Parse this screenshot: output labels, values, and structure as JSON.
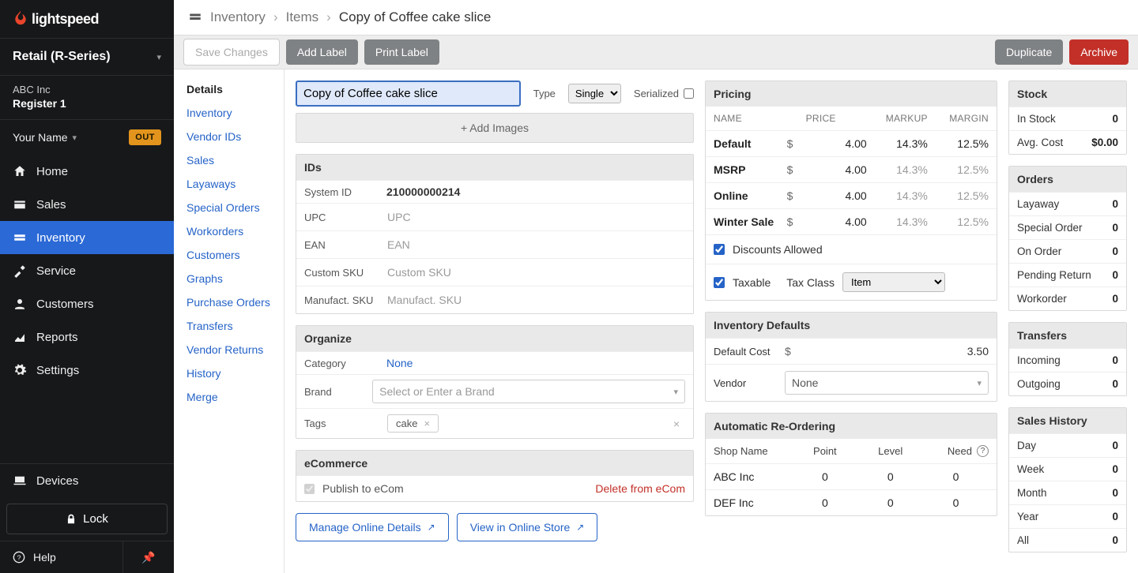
{
  "brand": {
    "name": "lightspeed"
  },
  "series": "Retail (R-Series)",
  "company": {
    "name": "ABC Inc",
    "register": "Register 1"
  },
  "user": {
    "name": "Your Name",
    "status_badge": "OUT"
  },
  "nav": {
    "home": "Home",
    "sales": "Sales",
    "inventory": "Inventory",
    "service": "Service",
    "customers": "Customers",
    "reports": "Reports",
    "settings": "Settings",
    "devices": "Devices",
    "lock": "Lock",
    "help": "Help"
  },
  "breadcrumb": {
    "l1": "Inventory",
    "l2": "Items",
    "l3": "Copy of Coffee cake slice"
  },
  "actions": {
    "save": "Save Changes",
    "add_label": "Add Label",
    "print_label": "Print Label",
    "duplicate": "Duplicate",
    "archive": "Archive"
  },
  "tabs": {
    "details": "Details",
    "inventory": "Inventory",
    "vendor_ids": "Vendor IDs",
    "sales": "Sales",
    "layaways": "Layaways",
    "special_orders": "Special Orders",
    "workorders": "Workorders",
    "customers": "Customers",
    "graphs": "Graphs",
    "purchase_orders": "Purchase Orders",
    "transfers": "Transfers",
    "vendor_returns": "Vendor Returns",
    "history": "History",
    "merge": "Merge"
  },
  "item": {
    "title": "Copy of Coffee cake slice",
    "type_label": "Type",
    "type_value": "Single",
    "serialized_label": "Serialized"
  },
  "add_images": "+ Add Images",
  "ids": {
    "head": "IDs",
    "system_id_label": "System ID",
    "system_id_value": "210000000214",
    "upc_label": "UPC",
    "upc_ph": "UPC",
    "ean_label": "EAN",
    "ean_ph": "EAN",
    "custom_sku_label": "Custom SKU",
    "custom_sku_ph": "Custom SKU",
    "manuf_sku_label": "Manufact. SKU",
    "manuf_sku_ph": "Manufact. SKU"
  },
  "organize": {
    "head": "Organize",
    "category_label": "Category",
    "category_value": "None",
    "brand_label": "Brand",
    "brand_ph": "Select or Enter a Brand",
    "tags_label": "Tags",
    "tag0": "cake"
  },
  "ecom": {
    "head": "eCommerce",
    "publish_label": "Publish to eCom",
    "delete_label": "Delete from eCom",
    "manage": "Manage Online Details",
    "view": "View in Online Store"
  },
  "pricing": {
    "head": "Pricing",
    "cols": {
      "name": "NAME",
      "price": "PRICE",
      "markup": "MARKUP",
      "margin": "MARGIN"
    },
    "rows": [
      {
        "name": "Default",
        "cur": "$",
        "price": "4.00",
        "markup": "14.3%",
        "margin": "12.5%",
        "default": true
      },
      {
        "name": "MSRP",
        "cur": "$",
        "price": "4.00",
        "markup": "14.3%",
        "margin": "12.5%"
      },
      {
        "name": "Online",
        "cur": "$",
        "price": "4.00",
        "markup": "14.3%",
        "margin": "12.5%"
      },
      {
        "name": "Winter Sale",
        "cur": "$",
        "price": "4.00",
        "markup": "14.3%",
        "margin": "12.5%"
      }
    ],
    "discounts_label": "Discounts Allowed",
    "taxable_label": "Taxable",
    "tax_class_label": "Tax Class",
    "tax_class_value": "Item"
  },
  "inv_defaults": {
    "head": "Inventory Defaults",
    "default_cost_label": "Default Cost",
    "default_cost_cur": "$",
    "default_cost_value": "3.50",
    "vendor_label": "Vendor",
    "vendor_value": "None"
  },
  "reorder": {
    "head": "Automatic Re-Ordering",
    "cols": {
      "shop": "Shop Name",
      "point": "Point",
      "level": "Level",
      "need": "Need"
    },
    "rows": [
      {
        "shop": "ABC Inc",
        "point": "0",
        "level": "0",
        "need": "0"
      },
      {
        "shop": "DEF Inc",
        "point": "0",
        "level": "0",
        "need": "0"
      }
    ]
  },
  "stock": {
    "head": "Stock",
    "in_stock_label": "In Stock",
    "in_stock_val": "0",
    "avg_cost_label": "Avg. Cost",
    "avg_cost_val": "$0.00"
  },
  "orders": {
    "head": "Orders",
    "layaway": "Layaway",
    "layaway_v": "0",
    "special": "Special Order",
    "special_v": "0",
    "on_order": "On Order",
    "on_order_v": "0",
    "pending": "Pending Return",
    "pending_v": "0",
    "workorder": "Workorder",
    "workorder_v": "0"
  },
  "transfers": {
    "head": "Transfers",
    "incoming": "Incoming",
    "incoming_v": "0",
    "outgoing": "Outgoing",
    "outgoing_v": "0"
  },
  "sales_history": {
    "head": "Sales History",
    "day": "Day",
    "day_v": "0",
    "week": "Week",
    "week_v": "0",
    "month": "Month",
    "month_v": "0",
    "year": "Year",
    "year_v": "0",
    "all": "All",
    "all_v": "0"
  }
}
